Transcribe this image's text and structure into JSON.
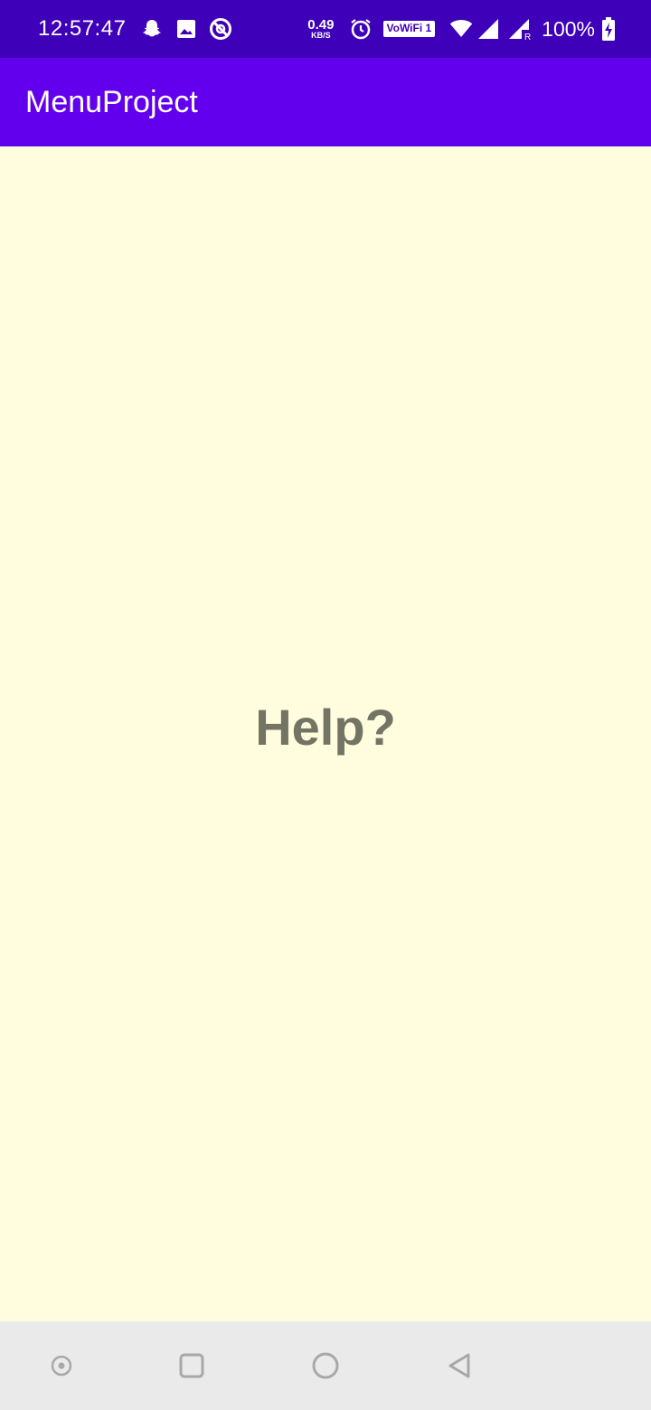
{
  "status_bar": {
    "time": "12:57:47",
    "net_speed_value": "0.49",
    "net_speed_unit": "KB/S",
    "wifi_badge": "VoWiFi 1",
    "battery": "100%",
    "icons": [
      "snapchat-icon",
      "gallery-icon",
      "do-not-disturb-icon",
      "alarm-icon",
      "wifi-icon",
      "signal-icon",
      "signal-roaming-icon",
      "battery-charging-icon"
    ]
  },
  "app_bar": {
    "title": "MenuProject"
  },
  "main": {
    "message": "Help?"
  },
  "nav_bar": {
    "icons": [
      "recent-dot-icon",
      "overview-square-icon",
      "home-circle-icon",
      "back-triangle-icon"
    ]
  },
  "colors": {
    "status_bar": "#3E00B8",
    "app_bar": "#6200EE",
    "background": "#FFFDDE",
    "message_text": "#747464",
    "nav_bar": "#EAEAEA"
  }
}
